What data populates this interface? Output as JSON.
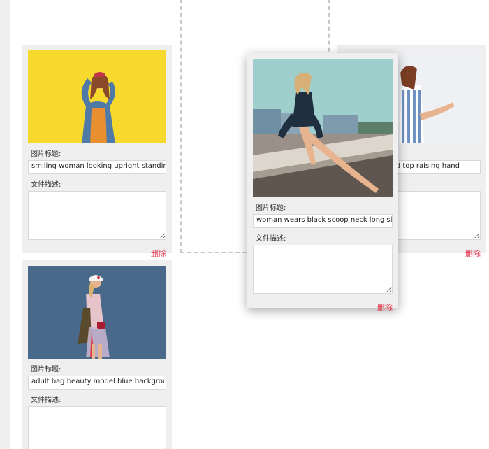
{
  "labels": {
    "title_label": "图片标题:",
    "desc_label": "文件描述:",
    "delete_label": "删除"
  },
  "cards": [
    {
      "title_value": "smiling woman looking upright standing again",
      "desc_value": ""
    },
    {
      "title_value": "adult bag beauty model blue background fashion",
      "desc_value": ""
    },
    {
      "title_value": "woman wears black scoop neck long sleeve dress",
      "desc_value": ""
    },
    {
      "title_value": "woman in blue and white striped top raising hand",
      "desc_value": ""
    }
  ],
  "colors": {
    "card_bg": "#efefef",
    "delete_red": "#e0334a",
    "placeholder_dash": "#c8c8c8"
  }
}
